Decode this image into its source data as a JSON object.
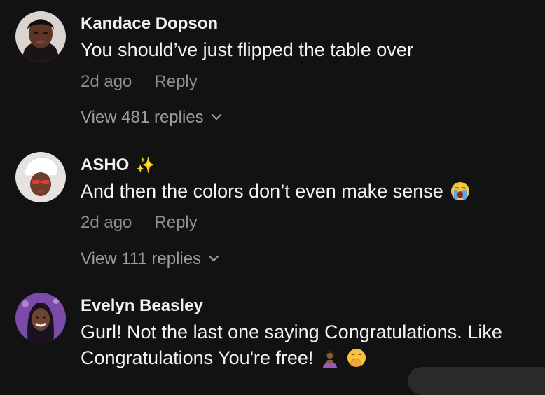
{
  "comments": [
    {
      "username": "Kandace Dopson",
      "text": "You should’ve just flipped the table over",
      "time": "2d ago",
      "reply_label": "Reply",
      "view_replies": "View 481 replies"
    },
    {
      "username": "ASHO",
      "username_emoji": "✨",
      "text": "And then the colors don’t even make sense",
      "text_emoji": "loudly-crying-face-icon",
      "time": "2d ago",
      "reply_label": "Reply",
      "view_replies": "View 111 replies"
    },
    {
      "username": "Evelyn Beasley",
      "text": "Gurl! Not the last one saying Congratulations. Like Congratulations You're free!",
      "text_emojis": [
        "person-bowing-icon",
        "face-with-hand-over-mouth-icon"
      ]
    }
  ],
  "colors": {
    "background": "#121212",
    "username": "#f1f1f1",
    "text": "#f4f4f4",
    "meta": "#8f8f8f",
    "sparkle": "#f5c030"
  }
}
